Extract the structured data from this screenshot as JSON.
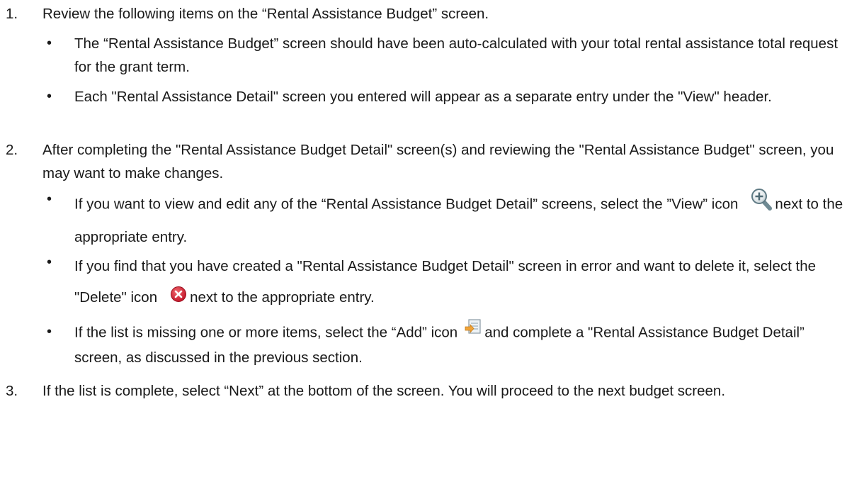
{
  "items": [
    {
      "number": "1.",
      "text": "Review the following items on the “Rental Assistance Budget” screen.",
      "bullets": [
        {
          "text": "The “Rental Assistance Budget” screen should have been auto-calculated with your total rental assistance total request for the grant term."
        },
        {
          "text": "Each \"Rental Assistance Detail\" screen you entered will appear as a separate entry under the \"View\" header."
        }
      ]
    },
    {
      "number": "2.",
      "text": "After completing the \"Rental Assistance Budget Detail\" screen(s) and reviewing the \"Rental Assistance Budget\" screen, you may want to make changes.",
      "bullets": [
        {
          "before": "If you want to view and edit any of the “Rental Assistance Budget Detail” screens, select the ”View” icon",
          "icon": "view-icon",
          "after": "next to the appropriate entry."
        },
        {
          "before": "If you find that you have created a \"Rental Assistance Budget Detail\" screen in error and want to delete it, select the \"Delete\" icon",
          "icon": "delete-icon",
          "after": "next to the appropriate entry."
        },
        {
          "before": "If the list is missing one or more items, select the “Add” icon",
          "icon": "add-icon",
          "after": "and complete a \"Rental Assistance Budget Detail” screen, as discussed in the previous section."
        }
      ]
    },
    {
      "number": "3.",
      "text": "If the list is complete, select “Next” at the bottom of the screen. You will proceed to the next budget screen."
    }
  ],
  "bullet_symbol": "•",
  "colors": {
    "text": "#1a1a1a",
    "delete_icon": "#d42a35",
    "view_icon": "#6f8a93",
    "add_icon": "#f0a43a"
  }
}
